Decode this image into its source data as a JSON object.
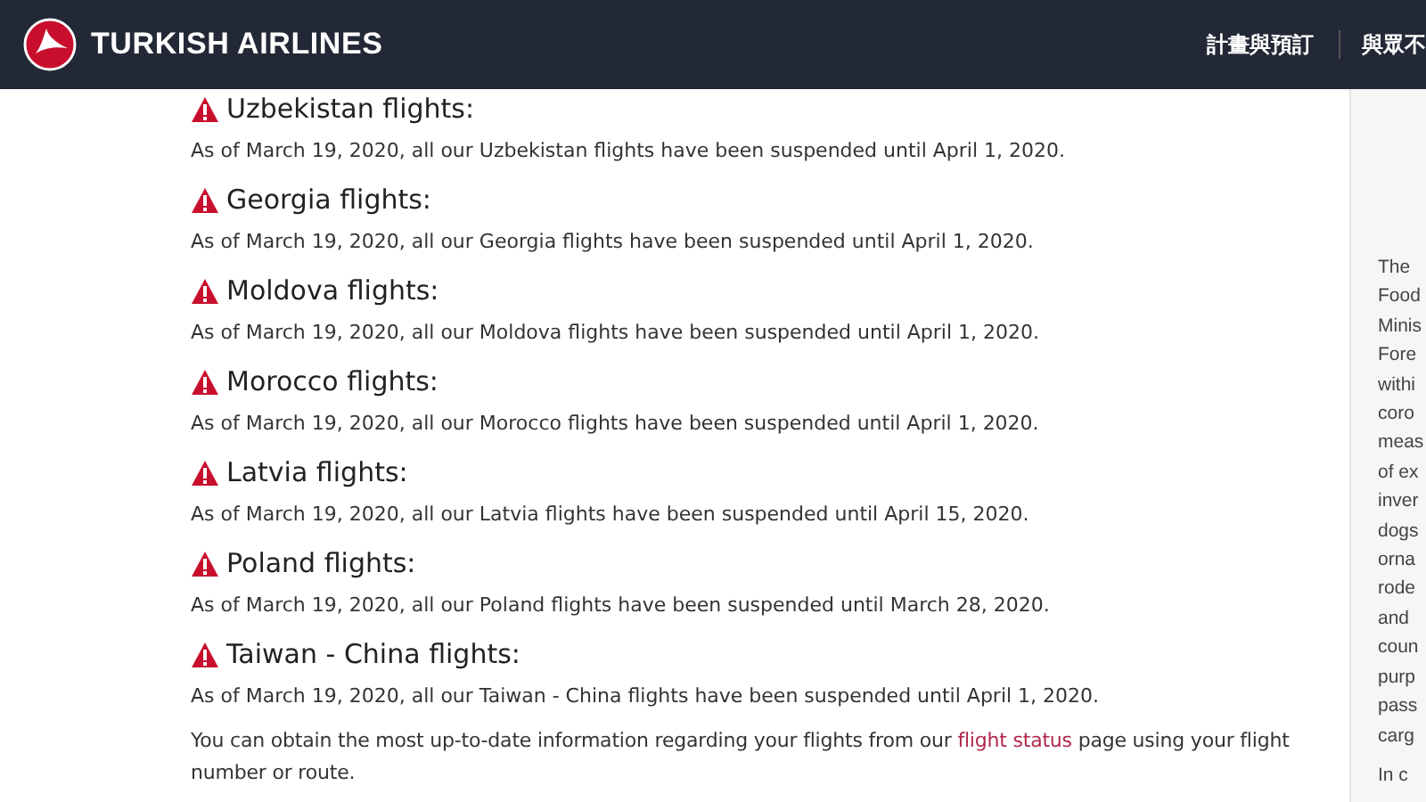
{
  "header": {
    "brand": "TURKISH AIRLINES",
    "nav": [
      "計畫與預訂",
      "與眾不"
    ]
  },
  "notices": [
    {
      "heading": "Uzbekistan flights:",
      "text": "As of March 19, 2020, all our Uzbekistan flights have been suspended until April 1, 2020."
    },
    {
      "heading": "Georgia flights:",
      "text": "As of March 19, 2020, all our Georgia flights have been suspended until April 1, 2020."
    },
    {
      "heading": "Moldova flights:",
      "text": "As of March 19, 2020, all our Moldova flights have been suspended until April 1, 2020."
    },
    {
      "heading": "Morocco flights:",
      "text": "As of March 19, 2020, all our Morocco flights have been suspended until April 1, 2020."
    },
    {
      "heading": "Latvia flights:",
      "text": "As of March 19, 2020, all our Latvia flights have been suspended until April 15, 2020."
    },
    {
      "heading": "Poland flights:",
      "text": "As of March 19, 2020, all our Poland flights have been suspended until March 28, 2020."
    },
    {
      "heading": "Taiwan - China flights:",
      "text": "As of March 19, 2020, all our Taiwan - China flights have been suspended until April 1, 2020."
    }
  ],
  "footer": {
    "before": "You can obtain the most up-to-date information regarding your flights from our",
    "link": "flight status",
    "after": "page using your flight number or route."
  },
  "sidebar": {
    "lines": [
      "The",
      "Food",
      "Minis",
      "Fore",
      "withi",
      "coro",
      "meas",
      "of ex",
      "inver",
      "dogs",
      "orna",
      "rode",
      "and",
      "coun",
      "purp",
      "pass",
      "carg"
    ],
    "next_line": "In c"
  }
}
